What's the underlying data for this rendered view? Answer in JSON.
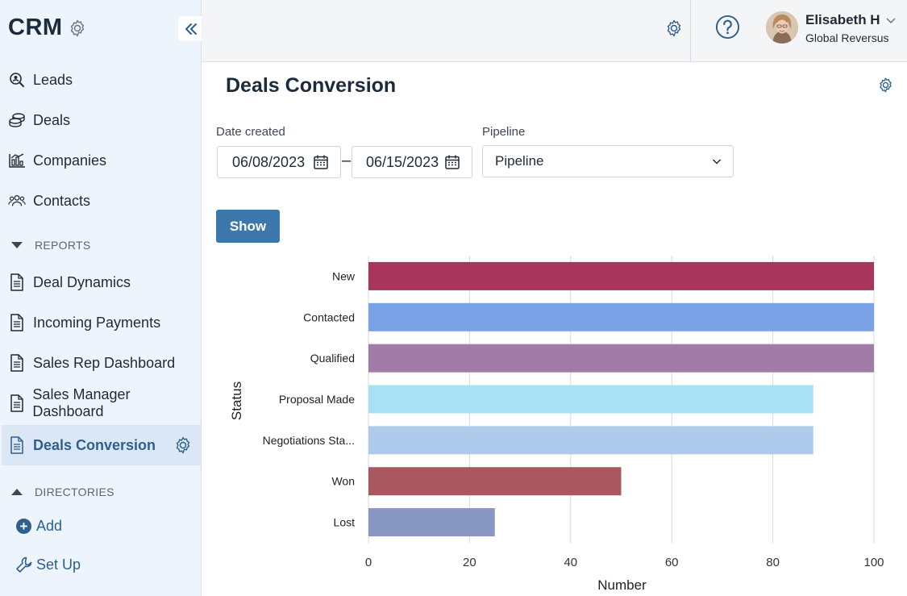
{
  "sidebar": {
    "brand": "CRM",
    "items": [
      {
        "label": "Leads",
        "icon": "search-user-icon"
      },
      {
        "label": "Deals",
        "icon": "coins-icon"
      },
      {
        "label": "Companies",
        "icon": "chart-bars-icon"
      },
      {
        "label": "Contacts",
        "icon": "people-icon"
      }
    ],
    "reports_label": "REPORTS",
    "reports": [
      {
        "label": "Deal Dynamics"
      },
      {
        "label": "Incoming Payments"
      },
      {
        "label": "Sales Rep Dashboard"
      },
      {
        "label": "Sales Manager Dashboard"
      },
      {
        "label": "Deals Conversion",
        "active": true
      }
    ],
    "directories_label": "DIRECTORIES",
    "add_label": "Add",
    "setup_label": "Set Up"
  },
  "topbar": {
    "user_name": "Elisabeth H",
    "user_org": "Global Reversus"
  },
  "main": {
    "title": "Deals Conversion",
    "date_created_label": "Date created",
    "date_from": "06/08/2023",
    "date_to": "06/15/2023",
    "pipeline_label": "Pipeline",
    "pipeline_value": "Pipeline",
    "show_label": "Show"
  },
  "colors": {
    "accent": "#3d78ad",
    "sidebar_bg": "#eef4fb",
    "active_text": "#2d5f8f"
  },
  "chart_data": {
    "type": "bar",
    "orientation": "horizontal",
    "categories": [
      "New",
      "Contacted",
      "Qualified",
      "Proposal Made",
      "Negotiations Sta...",
      "Won",
      "Lost"
    ],
    "values": [
      100,
      100,
      100,
      88,
      88,
      50,
      25
    ],
    "bar_colors": [
      "#a7355c",
      "#7aa2e6",
      "#a27ca8",
      "#a8e1f5",
      "#aecbeb",
      "#a9585f",
      "#8896c2"
    ],
    "xlabel": "Number",
    "ylabel": "Status",
    "xlim": [
      0,
      100
    ],
    "xticks": [
      0,
      20,
      40,
      60,
      80,
      100
    ],
    "grid": "vertical"
  }
}
